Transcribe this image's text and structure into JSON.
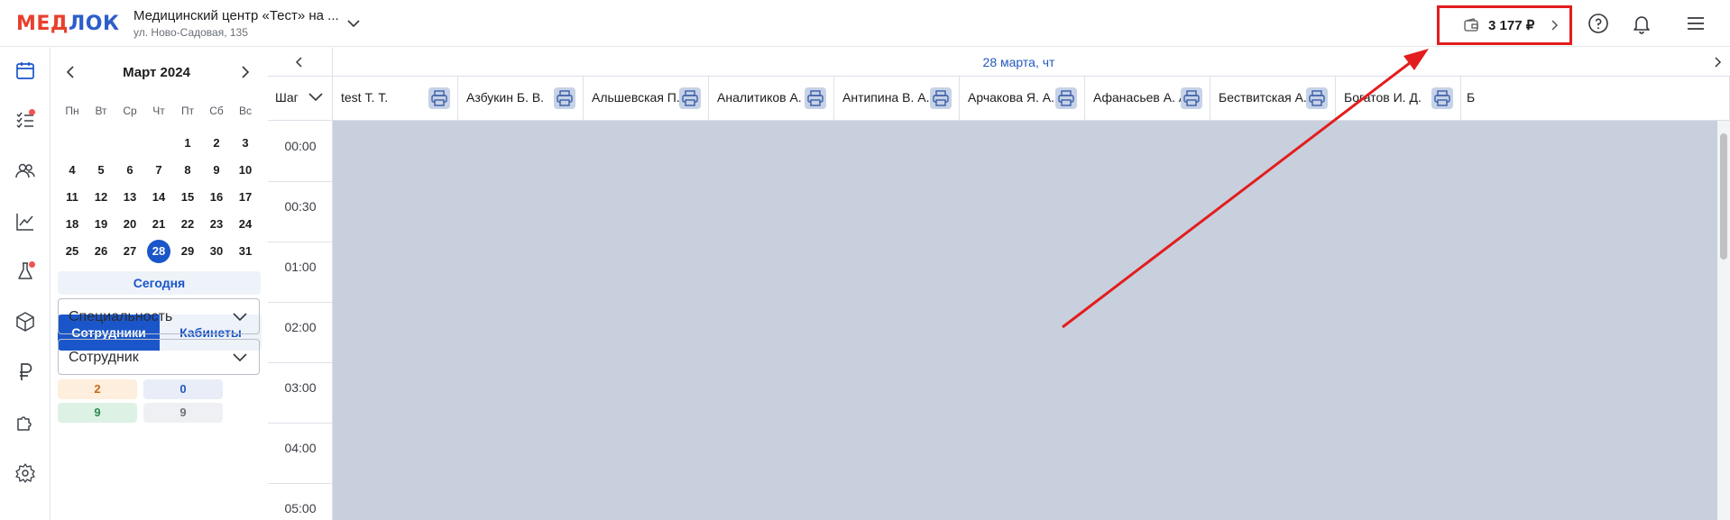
{
  "header": {
    "logo_text": "МЕДЛОК",
    "clinic_name": "Медицинский центр «Тест» на ...",
    "clinic_address": "ул. Ново-Садовая, 135",
    "balance": "3 177 ₽",
    "icons": [
      "wallet-icon",
      "chevron-right-icon",
      "help-icon",
      "bell-icon",
      "menu-icon"
    ]
  },
  "rail": {
    "items": [
      {
        "name": "calendar",
        "active": true,
        "badge": false
      },
      {
        "name": "tasks",
        "active": false,
        "badge": true
      },
      {
        "name": "patients",
        "active": false,
        "badge": false
      },
      {
        "name": "analytics",
        "active": false,
        "badge": false
      },
      {
        "name": "lab",
        "active": false,
        "badge": true
      },
      {
        "name": "warehouse",
        "active": false,
        "badge": false
      },
      {
        "name": "finance",
        "active": false,
        "badge": false
      },
      {
        "name": "integrations",
        "active": false,
        "badge": false
      },
      {
        "name": "settings",
        "active": false,
        "badge": false
      }
    ]
  },
  "calendar": {
    "month_label": "Март 2024",
    "weekdays": [
      "Пн",
      "Вт",
      "Ср",
      "Чт",
      "Пт",
      "Сб",
      "Вс"
    ],
    "days": [
      "",
      "",
      "",
      "",
      "1",
      "2",
      "3",
      "4",
      "5",
      "6",
      "7",
      "8",
      "9",
      "10",
      "11",
      "12",
      "13",
      "14",
      "15",
      "16",
      "17",
      "18",
      "19",
      "20",
      "21",
      "22",
      "23",
      "24",
      "25",
      "26",
      "27",
      "28",
      "29",
      "30",
      "31"
    ],
    "selected_day": "28",
    "today_label": "Сегодня"
  },
  "filters": {
    "tab_staff": "Сотрудники",
    "tab_rooms": "Кабинеты",
    "specialty_placeholder": "Специальность",
    "employee_placeholder": "Сотрудник",
    "counters": [
      {
        "value": "2",
        "bg": "#fdeedd",
        "color": "#c86a12"
      },
      {
        "value": "0",
        "bg": "#e8edf7",
        "color": "#2458bf"
      },
      {
        "value": "9",
        "bg": "#ddf2e5",
        "color": "#2d8a52"
      },
      {
        "value": "9",
        "bg": "#eef0f3",
        "color": "#6c717a"
      }
    ]
  },
  "schedule": {
    "date_label": "28 марта, чт",
    "step_label": "Шаг",
    "columns": [
      "test Т. Т.",
      "Азбукин Б. В.",
      "Альшевская П. ...",
      "Аналитиков А. А.",
      "Антипина В. А.",
      "Арчакова Я. А.",
      "Афанасьев А. А.",
      "Бествитская А. ...",
      "Богатов И. Д.",
      "Б"
    ],
    "times": [
      "00:00",
      "00:30",
      "01:00",
      "02:00",
      "03:00",
      "04:00",
      "05:00"
    ]
  },
  "colors": {
    "accent": "#1a56c9",
    "logo_red": "#e8402d",
    "logo_blue": "#2d5fc9",
    "annotation_red": "#e31d1d",
    "grid_bg": "#c8d0de"
  }
}
